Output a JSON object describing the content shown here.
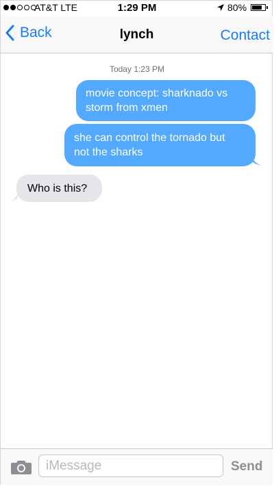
{
  "status_bar": {
    "signal_bars_filled": 2,
    "signal_bars_total": 5,
    "carrier": "AT&T LTE",
    "time": "1:29 PM",
    "location_icon": "location-arrow-icon",
    "battery_percent_label": "80%",
    "battery_level": 0.8
  },
  "nav": {
    "back_label": "Back",
    "title": "lynch",
    "contact_label": "Contact",
    "accent_color": "#1a7cf4"
  },
  "conversation": {
    "timestamp_day": "Today",
    "timestamp_time": "1:23 PM",
    "messages": [
      {
        "direction": "sent",
        "line1": "movie concept: sharknado vs",
        "line2": "storm from xmen"
      },
      {
        "direction": "sent",
        "line1": "she can control the tornado but",
        "line2": "not the sharks"
      },
      {
        "direction": "received",
        "line1": "Who is this?"
      }
    ],
    "sent_color": "#53a9fe",
    "received_color": "#e5e5ea"
  },
  "composer": {
    "camera_icon": "camera-icon",
    "placeholder": "iMessage",
    "value": "",
    "send_label": "Send"
  }
}
